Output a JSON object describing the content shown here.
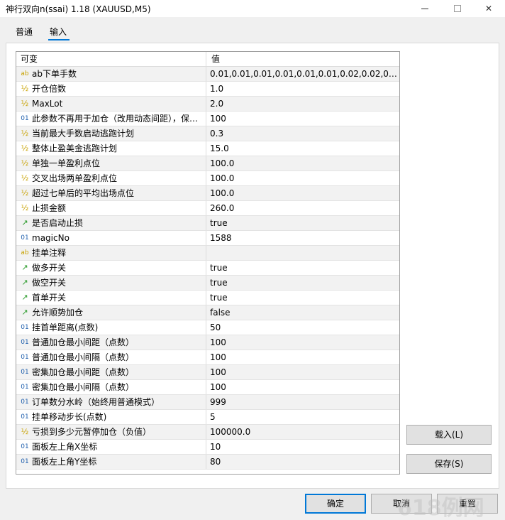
{
  "window": {
    "title": "神行双向n(ssai) 1.18 (XAUUSD,M5)",
    "minimize_glyph": "—",
    "close_glyph": "✕"
  },
  "tabs": [
    {
      "label": "普通",
      "active": false
    },
    {
      "label": "输入",
      "active": true
    }
  ],
  "grid": {
    "header": {
      "name": "可变",
      "value": "值"
    },
    "rows": [
      {
        "type": "ab",
        "type_icon": "ab",
        "name": "ab下单手数",
        "value": "0.01,0.01,0.01,0.01,0.01,0.01,0.02,0.02,0.02,0.…"
      },
      {
        "type": "frac",
        "type_icon": "½",
        "name": "开仓倍数",
        "value": "1.0"
      },
      {
        "type": "frac",
        "type_icon": "½",
        "name": "MaxLot",
        "value": "2.0"
      },
      {
        "type": "int",
        "type_icon": "01",
        "name": "此参数不再用于加仓（改用动态间距），保…",
        "value": "100"
      },
      {
        "type": "frac",
        "type_icon": "½",
        "name": "当前最大手数启动逃跑计划",
        "value": "0.3"
      },
      {
        "type": "frac",
        "type_icon": "½",
        "name": "整体止盈美金逃跑计划",
        "value": "15.0"
      },
      {
        "type": "frac",
        "type_icon": "½",
        "name": "单独一单盈利点位",
        "value": "100.0"
      },
      {
        "type": "frac",
        "type_icon": "½",
        "name": "交叉出场两单盈利点位",
        "value": "100.0"
      },
      {
        "type": "frac",
        "type_icon": "½",
        "name": "超过七单后的平均出场点位",
        "value": "100.0"
      },
      {
        "type": "frac",
        "type_icon": "½",
        "name": "止损金额",
        "value": "260.0"
      },
      {
        "type": "bool",
        "type_icon": "↗",
        "name": "是否启动止损",
        "value": "true"
      },
      {
        "type": "int",
        "type_icon": "01",
        "name": "magicNo",
        "value": "1588"
      },
      {
        "type": "ab",
        "type_icon": "ab",
        "name": "挂单注释",
        "value": ""
      },
      {
        "type": "bool",
        "type_icon": "↗",
        "name": "做多开关",
        "value": "true"
      },
      {
        "type": "bool",
        "type_icon": "↗",
        "name": "做空开关",
        "value": "true"
      },
      {
        "type": "bool",
        "type_icon": "↗",
        "name": "首单开关",
        "value": "true"
      },
      {
        "type": "bool",
        "type_icon": "↗",
        "name": "允许顺势加仓",
        "value": "false"
      },
      {
        "type": "int",
        "type_icon": "01",
        "name": "挂首单距离(点数)",
        "value": "50"
      },
      {
        "type": "int",
        "type_icon": "01",
        "name": "普通加仓最小间距（点数）",
        "value": "100"
      },
      {
        "type": "int",
        "type_icon": "01",
        "name": "普通加仓最小间隔（点数）",
        "value": "100"
      },
      {
        "type": "int",
        "type_icon": "01",
        "name": "密集加仓最小间距（点数）",
        "value": "100"
      },
      {
        "type": "int",
        "type_icon": "01",
        "name": "密集加仓最小间隔（点数）",
        "value": "100"
      },
      {
        "type": "int",
        "type_icon": "01",
        "name": "订单数分水岭（始终用普通模式）",
        "value": "999"
      },
      {
        "type": "int",
        "type_icon": "01",
        "name": "挂单移动步长(点数)",
        "value": "5"
      },
      {
        "type": "frac",
        "type_icon": "½",
        "name": "亏损到多少元暂停加仓（负值）",
        "value": "100000.0"
      },
      {
        "type": "int",
        "type_icon": "01",
        "name": "面板左上角X坐标",
        "value": "10"
      },
      {
        "type": "int",
        "type_icon": "01",
        "name": "面板左上角Y坐标",
        "value": "80"
      }
    ]
  },
  "side_buttons": {
    "load": "载入(L)",
    "save": "保存(S)"
  },
  "footer_buttons": {
    "ok": "确定",
    "cancel": "取消",
    "reset": "重置"
  },
  "watermark": "618例网",
  "colors": {
    "accent": "#0078d7",
    "alt_row": "#f2f2f2",
    "icon_ab": "#c8a200",
    "icon_int": "#1f5fad",
    "icon_bool": "#2a9b2a"
  }
}
